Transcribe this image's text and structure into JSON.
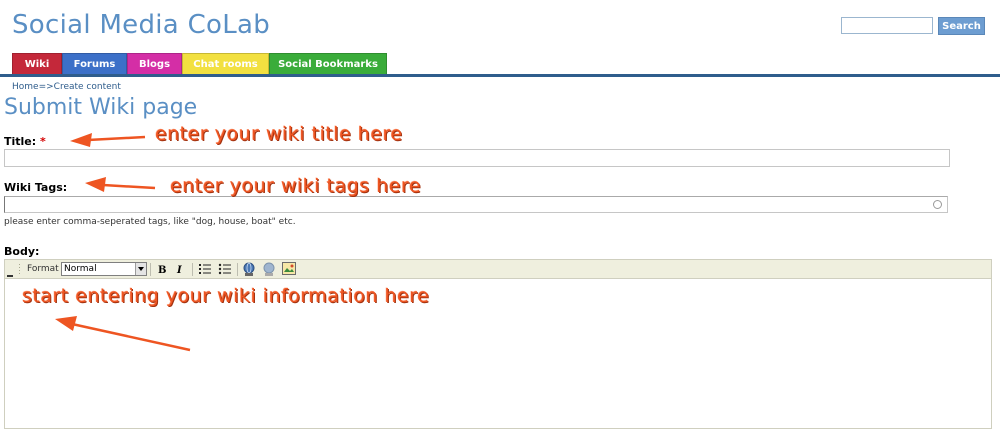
{
  "site": {
    "title": "Social Media CoLab"
  },
  "search": {
    "placeholder": "",
    "button_label": "Search"
  },
  "nav": {
    "tabs": [
      {
        "label": "Wiki",
        "color": "#c4283a"
      },
      {
        "label": "Forums",
        "color": "#3c70c8"
      },
      {
        "label": "Blogs",
        "color": "#d42ea6"
      },
      {
        "label": "Chat rooms",
        "color": "#f2e040"
      },
      {
        "label": "Social Bookmarks",
        "color": "#3aac3a"
      }
    ]
  },
  "breadcrumb": {
    "text": "Home=>Create content"
  },
  "page": {
    "title": "Submit Wiki page"
  },
  "form": {
    "title_label": "Title:",
    "required_mark": "*",
    "title_value": "",
    "tags_label": "Wiki Tags:",
    "tags_value": "",
    "tags_help": "please enter comma-seperated tags, like \"dog, house, boat\" etc.",
    "body_label": "Body:"
  },
  "editor": {
    "format_label": "Format",
    "format_value": "Normal",
    "toolbar_icons": [
      "bold-icon",
      "italic-icon",
      "ordered-list-icon",
      "unordered-list-icon",
      "link-icon",
      "unlink-icon",
      "image-icon"
    ]
  },
  "annotations": {
    "title_hint": "enter your wiki title here",
    "tags_hint": "enter your wiki tags here",
    "body_hint": "start entering your wiki information here",
    "color": "#ee5522"
  }
}
